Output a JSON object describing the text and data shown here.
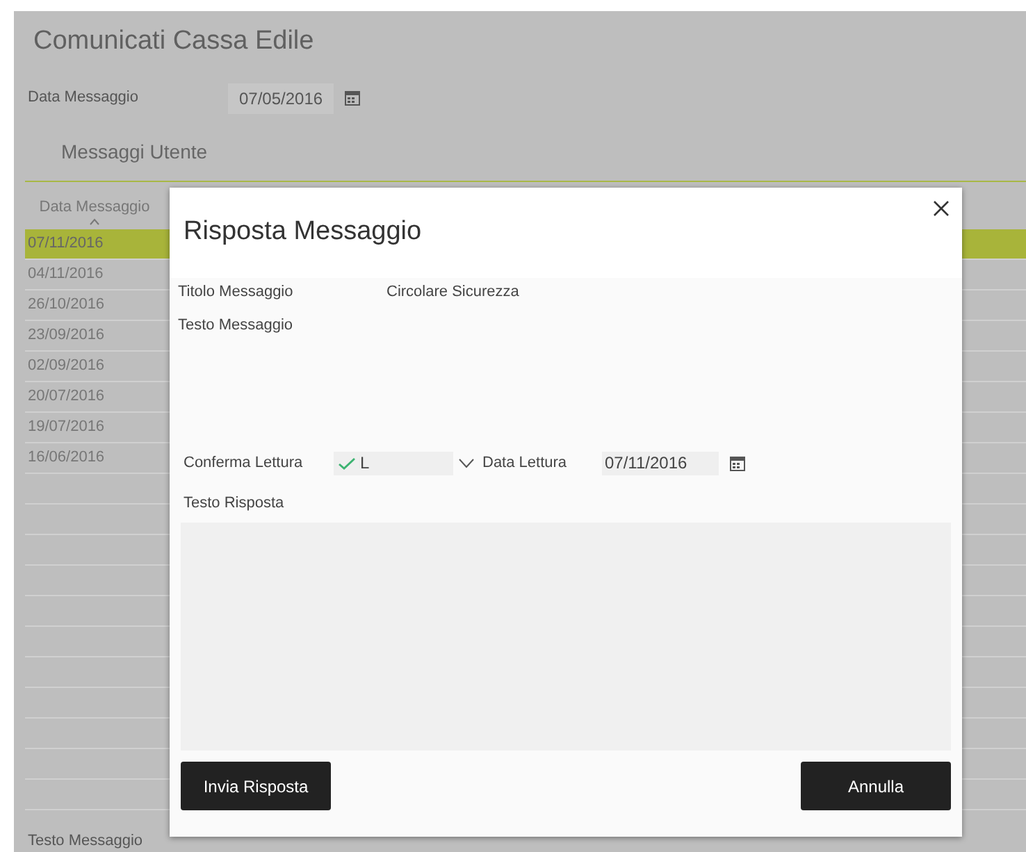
{
  "page": {
    "title": "Comunicati Cassa Edile",
    "date_filter": {
      "label": "Data Messaggio",
      "value": "07/05/2016"
    },
    "section_title": "Messaggi Utente",
    "footer_label": "Testo Messaggio"
  },
  "table": {
    "columns": [
      {
        "label": "Data Messaggio",
        "sorted": true
      }
    ],
    "rows": [
      {
        "date": "07/11/2016",
        "selected": true
      },
      {
        "date": "04/11/2016",
        "selected": false
      },
      {
        "date": "26/10/2016",
        "selected": false
      },
      {
        "date": "23/09/2016",
        "selected": false
      },
      {
        "date": "02/09/2016",
        "selected": false
      },
      {
        "date": "20/07/2016",
        "selected": false
      },
      {
        "date": "19/07/2016",
        "selected": false
      },
      {
        "date": "16/06/2016",
        "selected": false
      }
    ]
  },
  "dialog": {
    "title": "Risposta Messaggio",
    "title_label": "Titolo Messaggio",
    "title_value": "Circolare Sicurezza",
    "text_label": "Testo Messaggio",
    "confirm": {
      "label": "Conferma Lettura",
      "checked": true,
      "value": "L"
    },
    "read_date": {
      "label": "Data Lettura",
      "value": "07/11/2016"
    },
    "reply_label": "Testo Risposta",
    "buttons": [
      "Invia Risposta",
      "Annulla"
    ]
  }
}
